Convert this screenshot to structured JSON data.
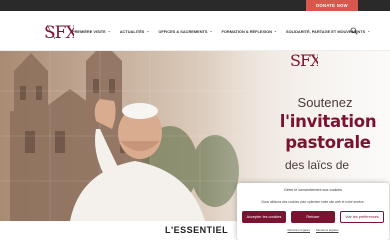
{
  "topbar": {
    "donate_label": "DONATE NOW"
  },
  "nav": {
    "logo_text": "SFX",
    "items": [
      {
        "label": "PREMIÈRE VISITE"
      },
      {
        "label": "ACTUALITÉS"
      },
      {
        "label": "OFFICES & SACREMENTS"
      },
      {
        "label": "FORMATION & RÉFLEXION"
      },
      {
        "label": "SOLIDARITÉ, PARTAGE ET MOUVEMENTS"
      }
    ]
  },
  "hero": {
    "logo_text": "SFX",
    "line1": "Soutenez",
    "line2": "l'invitation",
    "line3": "pastorale",
    "line4": "des laïcs de"
  },
  "section": {
    "title": "L'ESSENTIEL"
  },
  "cookie": {
    "title": "Gérer le consentement aux cookies",
    "text": "Nous utilisons des cookies pour optimiser notre site web et notre service.",
    "accept_label": "Accepter les cookies",
    "refuse_label": "Refuser",
    "prefs_label": "Voir les préférences",
    "link1": "Mentions légales",
    "link2": "Mentions légales"
  },
  "colors": {
    "brand": "#7a1230",
    "donate": "#d8584d",
    "topbar": "#2a2a2a"
  }
}
